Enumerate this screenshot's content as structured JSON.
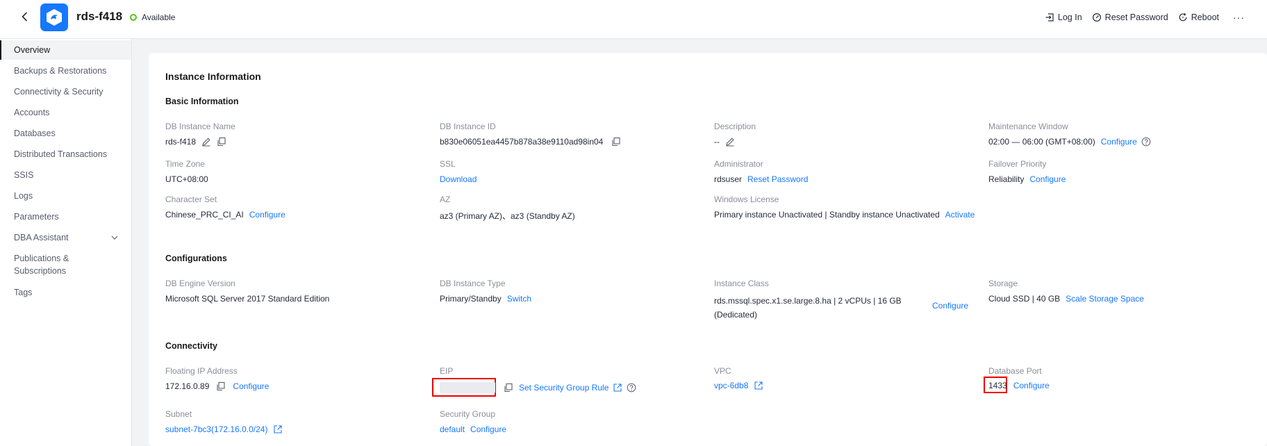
{
  "header": {
    "title": "rds-f418",
    "status": "Available",
    "actions": {
      "login": "Log In",
      "reset_password": "Reset Password",
      "reboot": "Reboot",
      "more": "···"
    }
  },
  "sidebar": {
    "items": [
      {
        "label": "Overview"
      },
      {
        "label": "Backups & Restorations"
      },
      {
        "label": "Connectivity & Security"
      },
      {
        "label": "Accounts"
      },
      {
        "label": "Databases"
      },
      {
        "label": "Distributed Transactions"
      },
      {
        "label": "SSIS"
      },
      {
        "label": "Logs"
      },
      {
        "label": "Parameters"
      },
      {
        "label": "DBA Assistant"
      },
      {
        "label": "Publications &"
      },
      {
        "label": "Subscriptions"
      },
      {
        "label": "Tags"
      }
    ]
  },
  "main": {
    "title": "Instance Information",
    "basic": {
      "title": "Basic Information",
      "name_label": "DB Instance Name",
      "name_value": "rds-f418",
      "id_label": "DB Instance ID",
      "id_value": "b830e06051ea4457b878a38e9110ad98in04",
      "desc_label": "Description",
      "desc_value": "--",
      "maint_label": "Maintenance Window",
      "maint_value": "02:00 — 06:00 (GMT+08:00)",
      "maint_link": "Configure",
      "tz_label": "Time Zone",
      "tz_value": "UTC+08:00",
      "ssl_label": "SSL",
      "ssl_link": "Download",
      "admin_label": "Administrator",
      "admin_value": "rdsuser",
      "admin_link": "Reset Password",
      "failover_label": "Failover Priority",
      "failover_value": "Reliability",
      "failover_link": "Configure",
      "charset_label": "Character Set",
      "charset_value": "Chinese_PRC_CI_AI",
      "charset_link": "Configure",
      "az_label": "AZ",
      "az_value": "az3 (Primary AZ)、az3 (Standby AZ)",
      "license_label": "Windows License",
      "license_value": "Primary instance Unactivated | Standby instance Unactivated",
      "license_link": "Activate"
    },
    "config": {
      "title": "Configurations",
      "engine_label": "DB Engine Version",
      "engine_value": "Microsoft SQL Server 2017 Standard Edition",
      "type_label": "DB Instance Type",
      "type_value": "Primary/Standby",
      "type_link": "Switch",
      "class_label": "Instance Class",
      "class_value_line1": "rds.mssql.spec.x1.se.large.8.ha | 2 vCPUs | 16 GB",
      "class_value_line2": "(Dedicated)",
      "class_link": "Configure",
      "storage_label": "Storage",
      "storage_value": "Cloud SSD | 40 GB",
      "storage_link": "Scale Storage Space"
    },
    "connectivity": {
      "title": "Connectivity",
      "fip_label": "Floating IP Address",
      "fip_value": "172.16.0.89",
      "fip_link": "Configure",
      "eip_label": "EIP",
      "eip_link": "Set Security Group Rule",
      "vpc_label": "VPC",
      "vpc_link": "vpc-6db8",
      "port_label": "Database Port",
      "port_value": "1433",
      "port_link": "Configure",
      "subnet_label": "Subnet",
      "subnet_link": "subnet-7bc3(172.16.0.0/24)",
      "sg_label": "Security Group",
      "sg_link": "default",
      "sg_configure": "Configure"
    }
  },
  "colors": {
    "accent": "#1677ff",
    "status_ok": "#52c41a",
    "highlight": "#ee0000"
  }
}
